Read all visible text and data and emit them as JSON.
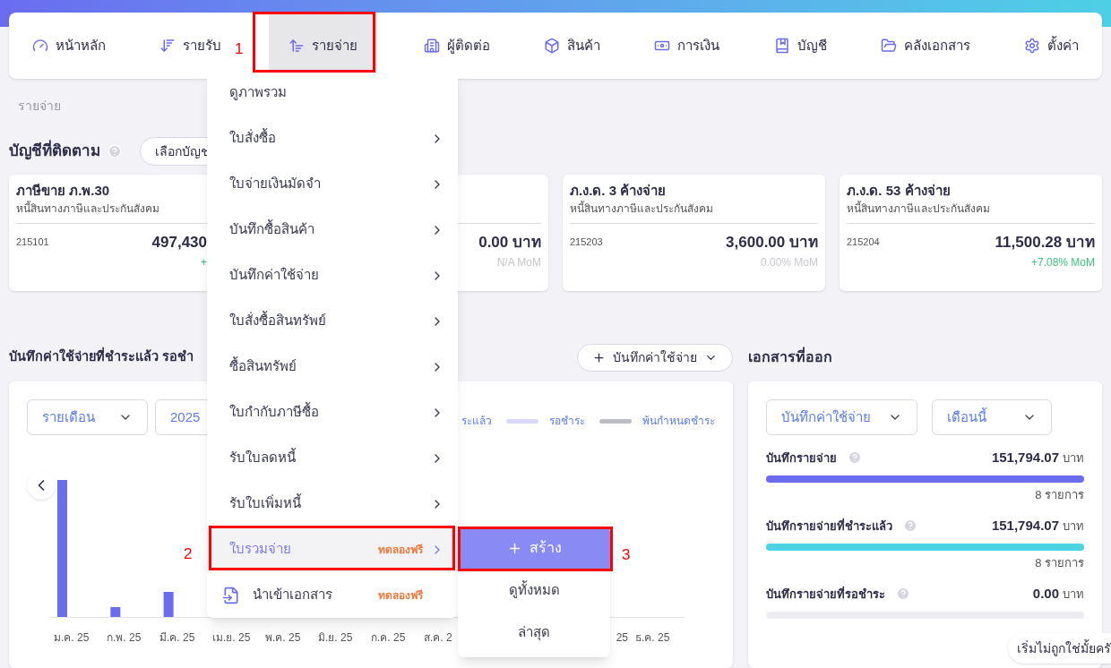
{
  "nav": {
    "items": [
      {
        "label": "หน้าหลัก",
        "selected": false
      },
      {
        "label": "รายรับ",
        "selected": false
      },
      {
        "label": "รายจ่าย",
        "selected": true
      },
      {
        "label": "ผู้ติดต่อ",
        "selected": false
      },
      {
        "label": "สินค้า",
        "selected": false
      },
      {
        "label": "การเงิน",
        "selected": false
      },
      {
        "label": "บัญชี",
        "selected": false
      },
      {
        "label": "คลังเอกสาร",
        "selected": false
      },
      {
        "label": "ตั้งค่า",
        "selected": false
      }
    ]
  },
  "breadcrumb": "รายจ่าย",
  "tracked": {
    "title": "บัญชีที่ติดตาม",
    "select_button": "เลือกบัญช",
    "cards": [
      {
        "title": "ภาษีขาย ภ.พ.30",
        "subtitle": "หนี้สินทางภาษีและประกันสังคม",
        "code": "215101",
        "amount": "497,430",
        "mom": "+",
        "positive": true
      },
      {
        "amount": "0.00 บาท",
        "mom": "N/A MoM",
        "positive": false
      },
      {
        "title": "ภ.ง.ด. 3 ค้างจ่าย",
        "subtitle": "หนี้สินทางภาษีและประกันสังคม",
        "code": "215203",
        "amount": "3,600.00 บาท",
        "mom": "0.00% MoM",
        "positive": false
      },
      {
        "title": "ภ.ง.ด. 53 ค้างจ่าย",
        "subtitle": "หนี้สินทางภาษีและประกันสังคม",
        "code": "215204",
        "amount": "11,500.28 บาท",
        "mom": "+7.08% MoM",
        "positive": true
      }
    ]
  },
  "expenses": {
    "title": "บันทึกค่าใช้จ่ายที่ชำระแล้ว รอชำ",
    "add_button": "บันทึกค่าใช้จ่าย",
    "period_select": "รายเดือน",
    "year_select": "2025",
    "legend": [
      {
        "label": "ระแล้ว"
      },
      {
        "label": "รอชำระ",
        "color": "#d9d8f8"
      },
      {
        "label": "พ้นกำหนดชำระ",
        "color": "#bdbdc6"
      }
    ],
    "x_labels": [
      "ม.ค. 25",
      "ก.พ. 25",
      "มี.ค. 25",
      "เม.ย. 25",
      "พ.ค. 25",
      "มิ.ย. 25",
      "ก.ค. 25",
      "ส.ค. 2",
      "25",
      "ธ.ค. 25"
    ]
  },
  "documents": {
    "title": "เอกสารที่ออก",
    "type_select": "บันทึกค่าใช้จ่าย",
    "period_select": "เดือนนี้",
    "rows": [
      {
        "label": "บันทึกรายจ่าย",
        "amount": "151,794.07",
        "unit": "บาท",
        "level": 1,
        "color": "#6c6cf0",
        "count": "8 รายการ"
      },
      {
        "label": "บันทึกรายจ่ายที่ชำระแล้ว",
        "amount": "151,794.07",
        "unit": "บาท",
        "level": 1,
        "color": "#4dd4e4",
        "count": "8 รายการ"
      },
      {
        "label": "บันทึกรายจ่ายที่รอชำระ",
        "amount": "0.00",
        "unit": "บาท",
        "level": 0
      }
    ]
  },
  "menu": {
    "items": [
      {
        "label": "ดูภาพรวม",
        "kind": "link",
        "submenu": false,
        "selected": false
      },
      {
        "label": "ใบสั่งซื้อ",
        "kind": "link",
        "submenu": true,
        "selected": false
      },
      {
        "label": "ใบจ่ายเงินมัดจำ",
        "kind": "link",
        "submenu": true,
        "selected": false
      },
      {
        "label": "บันทึกซื้อสินค้า",
        "kind": "link",
        "submenu": true,
        "selected": false
      },
      {
        "label": "บันทึกค่าใช้จ่าย",
        "kind": "link",
        "submenu": true,
        "selected": false
      },
      {
        "label": "ใบสั่งซื้อสินทรัพย์",
        "kind": "link",
        "submenu": true,
        "selected": false
      },
      {
        "label": "ซื้อสินทรัพย์",
        "kind": "link",
        "submenu": true,
        "selected": false
      },
      {
        "label": "ใบกำกับภาษีซื้อ",
        "kind": "link",
        "submenu": true,
        "selected": false
      },
      {
        "label": "รับใบลดหนี้",
        "kind": "link",
        "submenu": true,
        "selected": false
      },
      {
        "label": "รับใบเพิ่มหนี้",
        "kind": "link",
        "submenu": true,
        "selected": false
      },
      {
        "label": "ใบรวมจ่าย",
        "kind": "link",
        "submenu": true,
        "selected": true,
        "badge": "ทดลองฟรี"
      },
      {
        "label": "นำเข้าเอกสาร",
        "kind": "import",
        "submenu": false,
        "selected": false,
        "badge": "ทดลองฟรี"
      }
    ]
  },
  "submenu": {
    "create_button": "สร้าง",
    "items": [
      "ดูทั้งหมด",
      "ล่าสุด"
    ]
  },
  "annotations": [
    {
      "label": "1"
    },
    {
      "label": "2"
    },
    {
      "label": "3"
    }
  ],
  "toast": "เริ่มไม่ถูกใช่มั้ยครั"
}
